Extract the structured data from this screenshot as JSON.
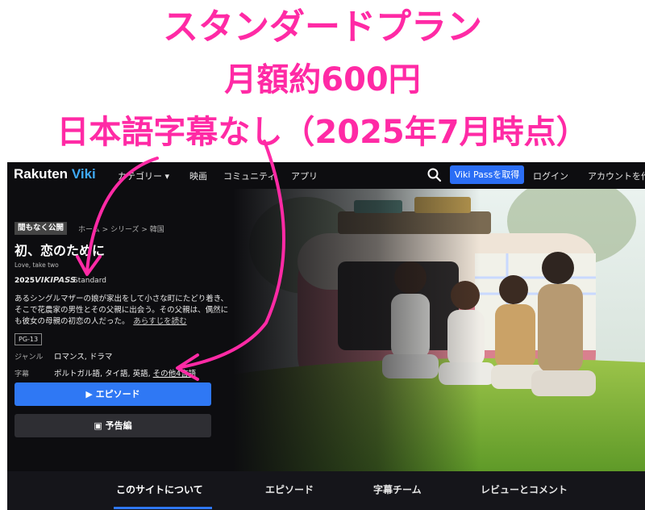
{
  "banner": {
    "line1": "スタンダードプラン",
    "line2": "月額約600円",
    "line3": "日本語字幕なし（2025年7月時点）"
  },
  "topbar": {
    "logo_rakuten": "Rakuten",
    "logo_viki": "Viki",
    "nav": [
      "カテゴリー ▾",
      "映画",
      "コミュニティ",
      "アプリ"
    ],
    "search_icon": "search-icon",
    "pass_button": "Viki Passを取得",
    "login": "ログイン",
    "account": "アカウントを作"
  },
  "show": {
    "badge": "間もなく公開",
    "breadcrumb": "ホーム  >  シリーズ  >  韓国",
    "title": "初、恋のために",
    "subtitle": "Love, take two",
    "year": "2025",
    "pass_logo": "VIKIPASS",
    "pass_tier": "Standard",
    "description": "あるシングルマザーの娘が家出をして小さな町にたどり着き、そこで花農家の男性とその父親に出会う。その父親は、偶然にも彼女の母親の初恋の人だった。",
    "description_more": "あらすじを読む",
    "rating": "PG-13",
    "genre_label": "ジャンル",
    "genre_value": "ロマンス, ドラマ",
    "subs_label": "字幕",
    "subs_value": "ポルトガル語, タイ語, 英語,",
    "subs_more": "その他4言語",
    "episode_button": "▶ エピソード",
    "trailer_button": "予告編"
  },
  "tabs": [
    "このサイトについて",
    "エピソード",
    "字幕チーム",
    "レビューとコメント"
  ],
  "colors": {
    "banner_pink": "#ff2aa5",
    "accent_blue": "#2f78f4",
    "bg_dark": "#0d0d10"
  }
}
